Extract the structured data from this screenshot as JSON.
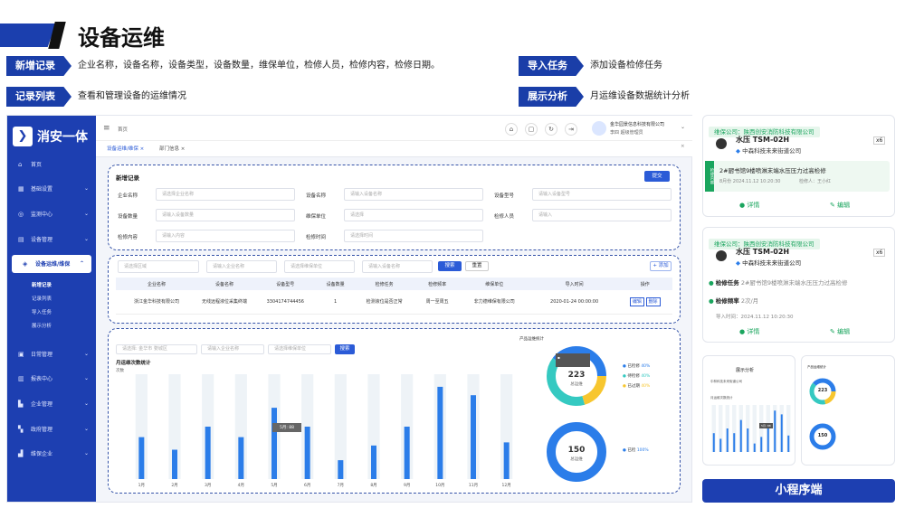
{
  "page": {
    "title": "设备运维"
  },
  "tags": [
    {
      "label": "新增记录",
      "desc": "企业名称，设备名称，设备类型，设备数量，维保单位，检修人员，检修内容，检修日期。"
    },
    {
      "label": "记录列表",
      "desc": "查看和管理设备的运维情况"
    },
    {
      "label": "导入任务",
      "desc": "添加设备检修任务"
    },
    {
      "label": "展示分析",
      "desc": "月运维设备数据统计分析"
    }
  ],
  "sidebar": {
    "logo": "消安一体",
    "items": [
      {
        "label": "首页",
        "icon": "home-icon"
      },
      {
        "label": "基础设置",
        "icon": "grid-icon"
      },
      {
        "label": "监测中心",
        "icon": "monitor-icon"
      },
      {
        "label": "设备管理",
        "icon": "device-icon"
      },
      {
        "label": "设备运维/维保",
        "icon": "shield-icon"
      },
      {
        "label": "日常管理",
        "icon": "calendar-icon"
      },
      {
        "label": "报表中心",
        "icon": "chart-icon"
      },
      {
        "label": "企业管理",
        "icon": "building-icon"
      },
      {
        "label": "政府管理",
        "icon": "gov-icon"
      },
      {
        "label": "维保企业",
        "icon": "company-icon"
      }
    ],
    "sub_items": [
      "新增记录",
      "记录列表",
      "导入任务",
      "展示分析"
    ]
  },
  "topbar": {
    "breadcrumb": "首页",
    "company": "金华园景信息科技有限公司",
    "user": "李四  超级管理员"
  },
  "tabs": [
    "设备运维/维保",
    "部门信息"
  ],
  "form": {
    "title": "新增记录",
    "submit": "提交",
    "fields": [
      {
        "label": "企业名称",
        "placeholder": "请选择企业名称"
      },
      {
        "label": "设备名称",
        "placeholder": "请输入设备名称"
      },
      {
        "label": "设备型号",
        "placeholder": "请输入设备型号"
      },
      {
        "label": "设备数量",
        "placeholder": "请输入设备数量"
      },
      {
        "label": "维保单位",
        "placeholder": "请选择"
      },
      {
        "label": "检修人员",
        "placeholder": "请输入"
      },
      {
        "label": "检修内容",
        "placeholder": "请输入内容"
      },
      {
        "label": "检修时间",
        "placeholder": "请选择时间"
      }
    ]
  },
  "list": {
    "filters": [
      "请选择区域",
      "请输入企业名称",
      "请选择维保单位",
      "请输入设备名称"
    ],
    "search": "搜索",
    "reset": "重置",
    "add": "+ 添加",
    "columns": [
      "企业名称",
      "设备名称",
      "设备型号",
      "设备数量",
      "检修任务",
      "检修频率",
      "维保单位",
      "导入时间",
      "操作"
    ],
    "rows": [
      [
        "浙江金华科技有限公司",
        "无线远程液位采集终端",
        "3304174744456",
        "1",
        "检测液位是否正常",
        "周一至周五",
        "非力德维保有限公司",
        "2020-01-24 00:00:00",
        ""
      ]
    ],
    "actions": [
      "编辑",
      "删除"
    ]
  },
  "analysis": {
    "filters": [
      "请选择: 金华市 婺城区",
      "请输入企业名称",
      "请选择维保单位"
    ],
    "search": "搜索",
    "chart_title": "月运维次数统计",
    "unit": "次数",
    "tooltip": "5月: 88",
    "donut_title": "产品运维统计",
    "donut1_value": "223",
    "donut1_label": "总运维",
    "donut2_value": "150",
    "donut2_label": "总运维",
    "legend1": [
      {
        "name": "已检修",
        "pct": "40%"
      },
      {
        "name": "待检修",
        "pct": "40%"
      },
      {
        "name": "已过期",
        "pct": "40%"
      }
    ],
    "legend2": [
      {
        "name": "已检",
        "pct": "100%"
      }
    ],
    "colors": {
      "blue": "#2b7de9",
      "cyan": "#35c9c1",
      "yellow": "#f7c62f"
    }
  },
  "chart_data": {
    "type": "bar",
    "categories": [
      "1月",
      "2月",
      "3月",
      "4月",
      "5月",
      "6月",
      "7月",
      "8月",
      "9月",
      "10月",
      "11月",
      "12月"
    ],
    "values": [
      40,
      28,
      50,
      40,
      68,
      50,
      18,
      32,
      50,
      88,
      80,
      35
    ],
    "ylim": [
      0,
      100
    ],
    "ylabel": "次数"
  },
  "cards": [
    {
      "company": "维保公司：陕西创安消防科技有限公司",
      "device": "水压 TSM-02H",
      "count": "x6",
      "address": "中森科技未来街道公司",
      "task_tag": "检修内容",
      "task": "2#厨书馆9楼喷淋末端水压压力过高检修",
      "time": "8月份  2024.11.12 10:20:30",
      "person": "检修人：王小红",
      "detail": "详情",
      "edit": "编辑"
    },
    {
      "company": "维保公司：陕西创安消防科技有限公司",
      "device": "水压 TSM-02H",
      "count": "x6",
      "address": "中森科技未来街道公司",
      "task_label": "检修任务",
      "task": "2#厨书馆9楼喷淋末端水压压力过高检修",
      "freq_label": "检修频率",
      "freq": "2次/月",
      "time": "导入时间：2024.11.12 10:20:30",
      "detail": "详情",
      "edit": "编辑"
    }
  ],
  "mini_app": {
    "title": "展示分析",
    "company": "中林科技未来街道公司",
    "chart": "月运维次数统计",
    "donut_title": "产品运维统计",
    "v1": "223",
    "v2": "150",
    "tooltip": "5月: 88"
  },
  "caption": "小程序端"
}
